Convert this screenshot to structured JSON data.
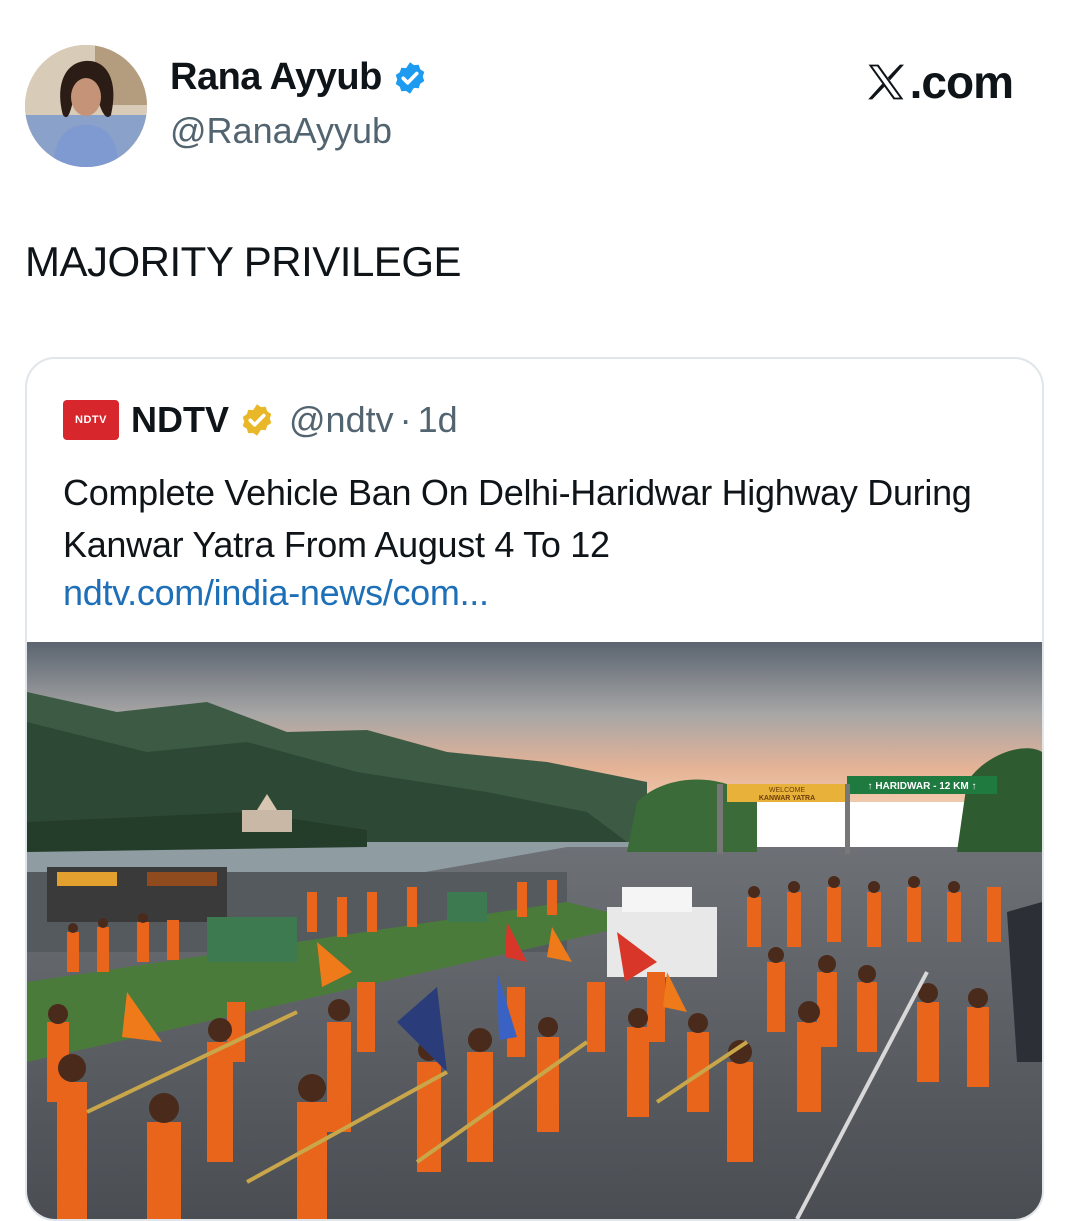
{
  "author": {
    "name": "Rana Ayyub",
    "handle": "@RanaAyyub",
    "avatar_icon": "profile-photo",
    "verified_color": "#1d9bf0"
  },
  "brand": {
    "text": ".com",
    "logo_icon": "x-logo"
  },
  "tweet": {
    "text": "MAJORITY PRIVILEGE"
  },
  "quote": {
    "logo_text": "NDTV",
    "name": "NDTV",
    "verified_color": "#e8b829",
    "handle": "@ndtv",
    "separator": "·",
    "time": "1d",
    "title": "Complete Vehicle Ban On Delhi-Haridwar Highway During Kanwar Yatra From August 4 To 12",
    "link": "ndtv.com/india-news/com...",
    "image": {
      "icon": "news-photo",
      "signs": {
        "welcome_line1": "WELCOME",
        "welcome_line2": "KANWAR YATRA",
        "direction": "↑ HARIDWAR - 12 KM ↑"
      }
    }
  }
}
